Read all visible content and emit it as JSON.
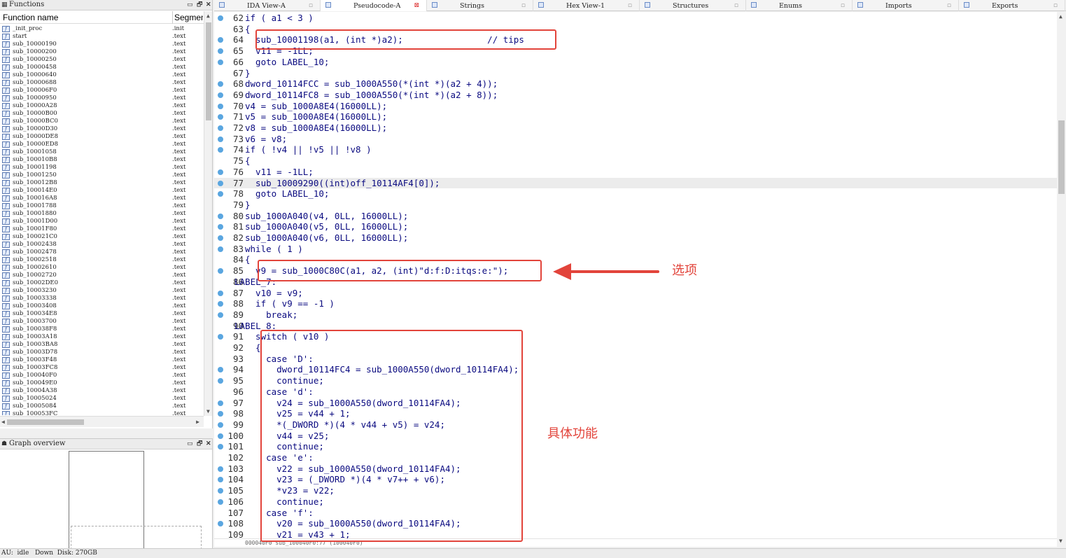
{
  "functions_panel": {
    "title": "Functions",
    "col_name": "Function name",
    "col_segment": "Segment",
    "rows": [
      {
        "name": "_init_proc",
        "seg": ".init"
      },
      {
        "name": "start",
        "seg": ".text"
      },
      {
        "name": "sub_10000190",
        "seg": ".text"
      },
      {
        "name": "sub_10000200",
        "seg": ".text"
      },
      {
        "name": "sub_10000250",
        "seg": ".text"
      },
      {
        "name": "sub_10000458",
        "seg": ".text"
      },
      {
        "name": "sub_10000640",
        "seg": ".text"
      },
      {
        "name": "sub_10000688",
        "seg": ".text"
      },
      {
        "name": "sub_100006F0",
        "seg": ".text"
      },
      {
        "name": "sub_10000950",
        "seg": ".text"
      },
      {
        "name": "sub_10000A28",
        "seg": ".text"
      },
      {
        "name": "sub_10000B00",
        "seg": ".text"
      },
      {
        "name": "sub_10000BC0",
        "seg": ".text"
      },
      {
        "name": "sub_10000D30",
        "seg": ".text"
      },
      {
        "name": "sub_10000DE8",
        "seg": ".text"
      },
      {
        "name": "sub_10000ED8",
        "seg": ".text"
      },
      {
        "name": "sub_10001058",
        "seg": ".text"
      },
      {
        "name": "sub_100010B8",
        "seg": ".text"
      },
      {
        "name": "sub_10001198",
        "seg": ".text"
      },
      {
        "name": "sub_10001250",
        "seg": ".text"
      },
      {
        "name": "sub_100012B8",
        "seg": ".text"
      },
      {
        "name": "sub_100014E0",
        "seg": ".text"
      },
      {
        "name": "sub_100016A8",
        "seg": ".text"
      },
      {
        "name": "sub_10001788",
        "seg": ".text"
      },
      {
        "name": "sub_10001880",
        "seg": ".text"
      },
      {
        "name": "sub_10001D00",
        "seg": ".text"
      },
      {
        "name": "sub_10001F80",
        "seg": ".text"
      },
      {
        "name": "sub_100021C0",
        "seg": ".text"
      },
      {
        "name": "sub_10002438",
        "seg": ".text"
      },
      {
        "name": "sub_10002478",
        "seg": ".text"
      },
      {
        "name": "sub_10002518",
        "seg": ".text"
      },
      {
        "name": "sub_10002610",
        "seg": ".text"
      },
      {
        "name": "sub_10002720",
        "seg": ".text"
      },
      {
        "name": "sub_10002DE0",
        "seg": ".text"
      },
      {
        "name": "sub_10003230",
        "seg": ".text"
      },
      {
        "name": "sub_10003338",
        "seg": ".text"
      },
      {
        "name": "sub_10003408",
        "seg": ".text"
      },
      {
        "name": "sub_100034E8",
        "seg": ".text"
      },
      {
        "name": "sub_10003700",
        "seg": ".text"
      },
      {
        "name": "sub_100038F8",
        "seg": ".text"
      },
      {
        "name": "sub_10003A18",
        "seg": ".text"
      },
      {
        "name": "sub_10003BA8",
        "seg": ".text"
      },
      {
        "name": "sub_10003D78",
        "seg": ".text"
      },
      {
        "name": "sub_10003F48",
        "seg": ".text"
      },
      {
        "name": "sub_10003FC8",
        "seg": ".text"
      },
      {
        "name": "sub_100040F0",
        "seg": ".text"
      },
      {
        "name": "sub_100049E0",
        "seg": ".text"
      },
      {
        "name": "sub_10004A38",
        "seg": ".text"
      },
      {
        "name": "sub_10005024",
        "seg": ".text"
      },
      {
        "name": "sub_10005084",
        "seg": ".text"
      },
      {
        "name": "sub_100053FC",
        "seg": ".text"
      }
    ]
  },
  "graph_panel": {
    "title": "Graph overview"
  },
  "tabs": [
    {
      "label": "IDA View-A",
      "active": false
    },
    {
      "label": "Pseudocode-A",
      "active": true
    },
    {
      "label": "Strings",
      "active": false
    },
    {
      "label": "Hex View-1",
      "active": false
    },
    {
      "label": "Structures",
      "active": false
    },
    {
      "label": "Enums",
      "active": false
    },
    {
      "label": "Imports",
      "active": false
    },
    {
      "label": "Exports",
      "active": false
    }
  ],
  "code_lines": [
    {
      "n": "62",
      "t": "if ( a1 < 3 )",
      "dot": true
    },
    {
      "n": "63",
      "t": "{",
      "dot": false
    },
    {
      "n": "64",
      "t": "  sub_10001198(a1, (int *)a2);                // tips",
      "dot": true
    },
    {
      "n": "65",
      "t": "  v11 = -1LL;",
      "dot": true
    },
    {
      "n": "66",
      "t": "  goto LABEL_10;",
      "dot": true
    },
    {
      "n": "67",
      "t": "}",
      "dot": false
    },
    {
      "n": "68",
      "t": "dword_10114FCC = sub_1000A550(*(int *)(a2 + 4));",
      "dot": true
    },
    {
      "n": "69",
      "t": "dword_10114FC8 = sub_1000A550(*(int *)(a2 + 8));",
      "dot": true
    },
    {
      "n": "70",
      "t": "v4 = sub_1000A8E4(16000LL);",
      "dot": true
    },
    {
      "n": "71",
      "t": "v5 = sub_1000A8E4(16000LL);",
      "dot": true
    },
    {
      "n": "72",
      "t": "v8 = sub_1000A8E4(16000LL);",
      "dot": true
    },
    {
      "n": "73",
      "t": "v6 = v8;",
      "dot": true
    },
    {
      "n": "74",
      "t": "if ( !v4 || !v5 || !v8 )",
      "dot": true
    },
    {
      "n": "75",
      "t": "{",
      "dot": false
    },
    {
      "n": "76",
      "t": "  v11 = -1LL;",
      "dot": true
    },
    {
      "n": "77",
      "t": "  sub_10009290((int)off_10114AF4[0]);",
      "dot": true,
      "hl": true
    },
    {
      "n": "78",
      "t": "  goto LABEL_10;",
      "dot": true
    },
    {
      "n": "79",
      "t": "}",
      "dot": false
    },
    {
      "n": "80",
      "t": "sub_1000A040(v4, 0LL, 16000LL);",
      "dot": true
    },
    {
      "n": "81",
      "t": "sub_1000A040(v5, 0LL, 16000LL);",
      "dot": true
    },
    {
      "n": "82",
      "t": "sub_1000A040(v6, 0LL, 16000LL);",
      "dot": true
    },
    {
      "n": "83",
      "t": "while ( 1 )",
      "dot": true
    },
    {
      "n": "84",
      "t": "{",
      "dot": false
    },
    {
      "n": "85",
      "t": "  v9 = sub_1000C80C(a1, a2, (int)\"d:f:D:itqs:e:\");",
      "dot": true
    },
    {
      "n": "86",
      "t": "LABEL_7:",
      "dot": false,
      "label": true
    },
    {
      "n": "87",
      "t": "  v10 = v9;",
      "dot": true
    },
    {
      "n": "88",
      "t": "  if ( v9 == -1 )",
      "dot": true
    },
    {
      "n": "89",
      "t": "    break;",
      "dot": true
    },
    {
      "n": "90",
      "t": "LABEL_8:",
      "dot": false,
      "label": true
    },
    {
      "n": "91",
      "t": "  switch ( v10 )",
      "dot": true
    },
    {
      "n": "92",
      "t": "  {",
      "dot": false
    },
    {
      "n": "93",
      "t": "    case 'D':",
      "dot": false
    },
    {
      "n": "94",
      "t": "      dword_10114FC4 = sub_1000A550(dword_10114FA4);",
      "dot": true
    },
    {
      "n": "95",
      "t": "      continue;",
      "dot": true
    },
    {
      "n": "96",
      "t": "    case 'd':",
      "dot": false
    },
    {
      "n": "97",
      "t": "      v24 = sub_1000A550(dword_10114FA4);",
      "dot": true
    },
    {
      "n": "98",
      "t": "      v25 = v44 + 1;",
      "dot": true
    },
    {
      "n": "99",
      "t": "      *(_DWORD *)(4 * v44 + v5) = v24;",
      "dot": true
    },
    {
      "n": "100",
      "t": "      v44 = v25;",
      "dot": true
    },
    {
      "n": "101",
      "t": "      continue;",
      "dot": true
    },
    {
      "n": "102",
      "t": "    case 'e':",
      "dot": false
    },
    {
      "n": "103",
      "t": "      v22 = sub_1000A550(dword_10114FA4);",
      "dot": true
    },
    {
      "n": "104",
      "t": "      v23 = (_DWORD *)(4 * v7++ + v6);",
      "dot": true
    },
    {
      "n": "105",
      "t": "      *v23 = v22;",
      "dot": true
    },
    {
      "n": "106",
      "t": "      continue;",
      "dot": true
    },
    {
      "n": "107",
      "t": "    case 'f':",
      "dot": false
    },
    {
      "n": "108",
      "t": "      v20 = sub_1000A550(dword_10114FA4);",
      "dot": true
    },
    {
      "n": "109",
      "t": "      v21 = v43 + 1;",
      "dot": false
    }
  ],
  "code_status": "000040F0 sub_100040F0:77 (100040F0)",
  "annotations": {
    "options_label": "选项",
    "function_label": "具体功能"
  },
  "status_bar": "AU:  idle   Down  Disk: 270GB",
  "colors": {
    "annotation": "#e2443b",
    "code_text": "#0a0a80",
    "breakpoint_dot": "#5aa6e0"
  }
}
